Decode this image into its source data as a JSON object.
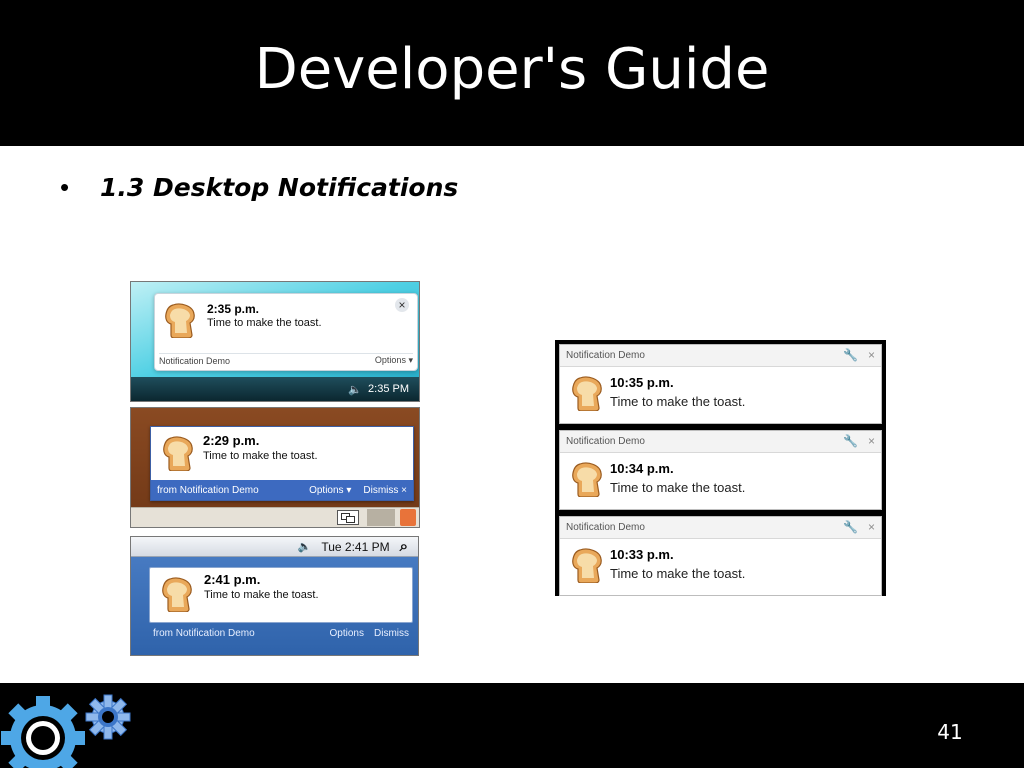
{
  "slide": {
    "title": "Developer's Guide",
    "bullet": "1.3 Desktop Notifications",
    "page_number": "41"
  },
  "vista": {
    "time": "2:35 p.m.",
    "message": "Time to make the toast.",
    "source": "Notification Demo",
    "options": "Options",
    "clock": "2:35 PM"
  },
  "linux": {
    "time": "2:29 p.m.",
    "message": "Time to make the toast.",
    "source": "from Notification Demo",
    "options": "Options",
    "dismiss": "Dismiss"
  },
  "mac": {
    "clock": "Tue 2:41 PM",
    "time": "2:41 p.m.",
    "message": "Time to make the toast.",
    "source": "from Notification Demo",
    "options": "Options",
    "dismiss": "Dismiss"
  },
  "chrome": {
    "notifications": [
      {
        "source": "Notification Demo",
        "time": "10:35 p.m.",
        "message": "Time to make the toast."
      },
      {
        "source": "Notification Demo",
        "time": "10:34 p.m.",
        "message": "Time to make the toast."
      },
      {
        "source": "Notification Demo",
        "time": "10:33 p.m.",
        "message": "Time to make the toast."
      }
    ]
  },
  "icons": {
    "bullet": "•",
    "close": "×",
    "options_arrow": "▾",
    "speaker": "🔈",
    "search": "⌕",
    "wrench": "🔧"
  },
  "colors": {
    "slide_bar": "#000000",
    "gear_blue": "#4ea7e6",
    "linux_footer": "#3d6ac0",
    "mac_blue": "#2f63ab"
  }
}
